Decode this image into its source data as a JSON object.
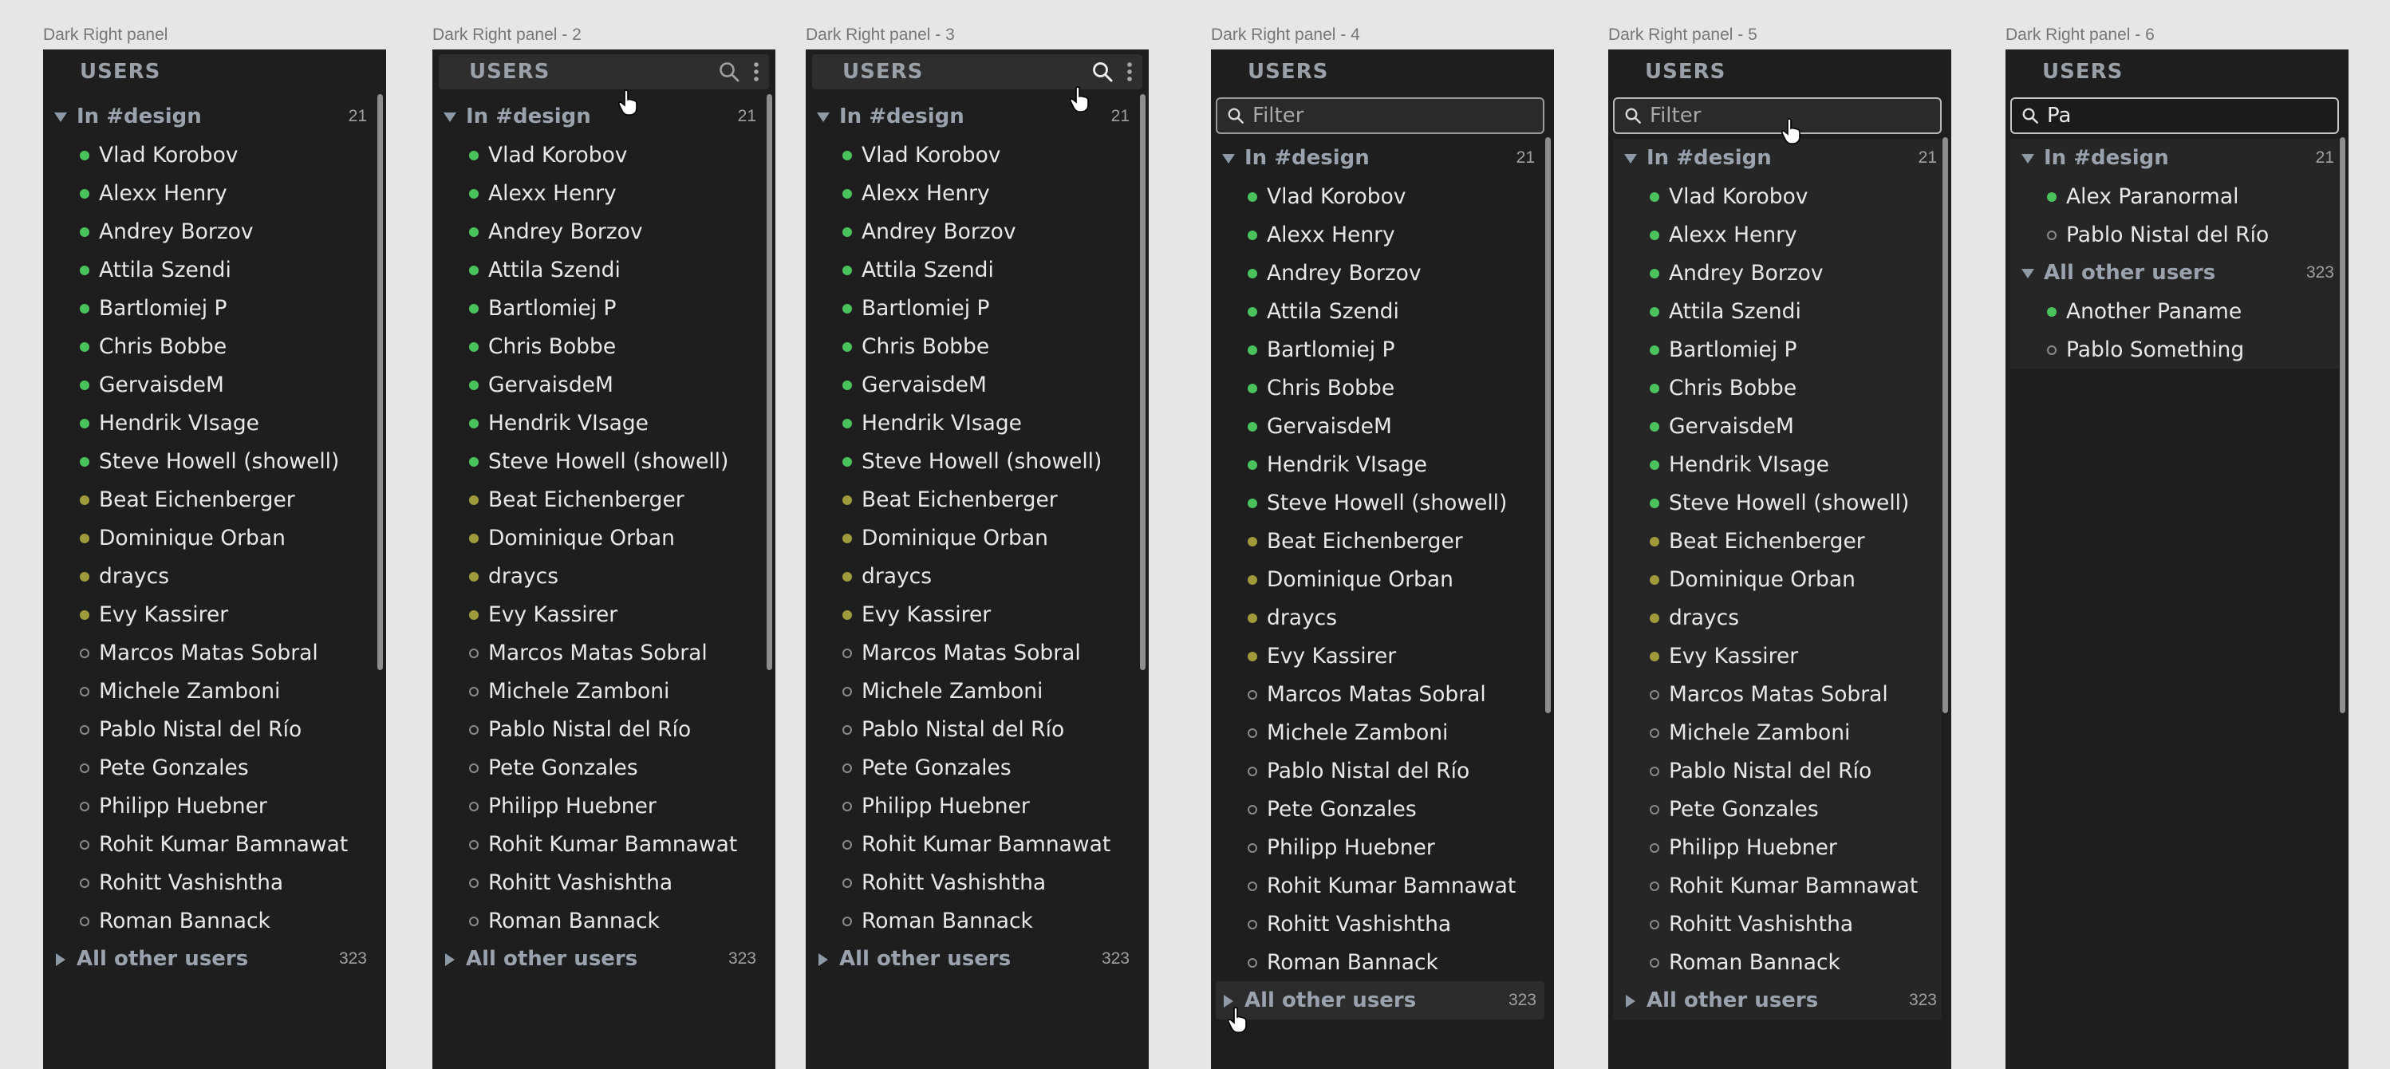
{
  "frames": [
    {
      "label": "Dark Right panel"
    },
    {
      "label": "Dark Right panel - 2"
    },
    {
      "label": "Dark Right panel - 3"
    },
    {
      "label": "Dark Right panel - 4"
    },
    {
      "label": "Dark Right panel - 5"
    },
    {
      "label": "Dark Right panel - 6"
    }
  ],
  "header": {
    "title": "USERS"
  },
  "search": {
    "placeholder": "Filter",
    "value_frame6": "Pa"
  },
  "groups": {
    "design": {
      "label": "In #design",
      "count": "21"
    },
    "other": {
      "label": "All other users",
      "count": "323"
    }
  },
  "users": [
    {
      "name": "Vlad Korobov",
      "status": "online"
    },
    {
      "name": "Alexx Henry",
      "status": "online"
    },
    {
      "name": "Andrey Borzov",
      "status": "online"
    },
    {
      "name": "Attila Szendi",
      "status": "online"
    },
    {
      "name": "Bartlomiej P",
      "status": "online"
    },
    {
      "name": "Chris Bobbe",
      "status": "online"
    },
    {
      "name": "GervaisdeM",
      "status": "online"
    },
    {
      "name": "Hendrik VIsage",
      "status": "online"
    },
    {
      "name": "Steve Howell (showell)",
      "status": "online"
    },
    {
      "name": "Beat Eichenberger",
      "status": "away"
    },
    {
      "name": "Dominique Orban",
      "status": "away"
    },
    {
      "name": "draycs",
      "status": "away"
    },
    {
      "name": "Evy Kassirer",
      "status": "away"
    },
    {
      "name": "Marcos Matas Sobral",
      "status": "offline"
    },
    {
      "name": "Michele Zamboni",
      "status": "offline"
    },
    {
      "name": "Pablo Nistal del Río",
      "status": "offline"
    },
    {
      "name": "Pete Gonzales",
      "status": "offline"
    },
    {
      "name": "Philipp Huebner",
      "status": "offline"
    },
    {
      "name": "Rohit Kumar Bamnawat",
      "status": "offline"
    },
    {
      "name": "Rohitt Vashishtha",
      "status": "offline"
    },
    {
      "name": "Roman Bannack",
      "status": "offline"
    }
  ],
  "filtered": {
    "design_users": [
      {
        "name": "Alex Paranormal",
        "status": "online"
      },
      {
        "name": "Pablo Nistal del Río",
        "status": "offline"
      }
    ],
    "other_users": [
      {
        "name": "Another Paname",
        "status": "online"
      },
      {
        "name": "Pablo Something",
        "status": "offline"
      }
    ]
  },
  "colors": {
    "online": "#4bc35d",
    "away": "#9f9a3a",
    "offline": "#8a8a8a",
    "panel": "#1e1e1e"
  },
  "icons": {
    "search": "search-icon",
    "more": "more-vertical-icon",
    "cursor": "hand-pointer-icon"
  }
}
